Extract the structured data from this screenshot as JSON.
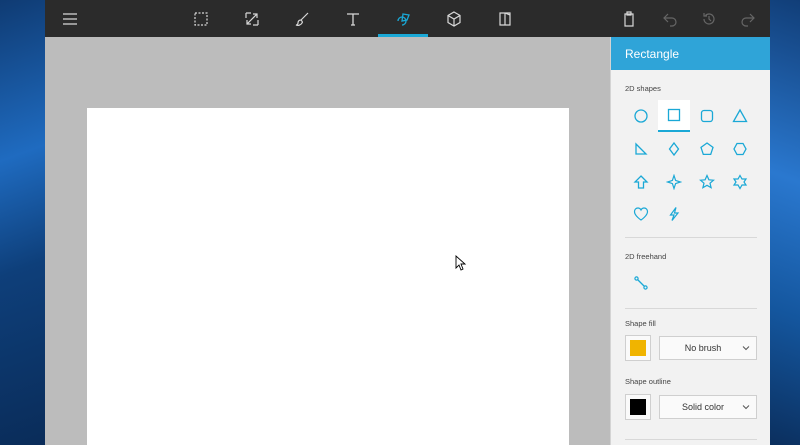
{
  "panel": {
    "title": "Rectangle",
    "shapes_2d_label": "2D shapes",
    "freehand_label": "2D freehand",
    "shape_fill": {
      "label": "Shape fill",
      "color": "#f0b400",
      "value": "No brush"
    },
    "shape_outline": {
      "label": "Shape outline",
      "color": "#000000",
      "value": "Solid color"
    }
  },
  "colors": {
    "accent": "#1aa8d6",
    "panel_header": "#2fa4d8",
    "toolbar": "#2b2b2b"
  }
}
